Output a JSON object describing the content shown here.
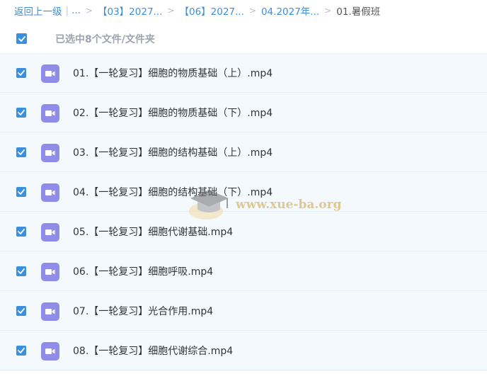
{
  "breadcrumb": {
    "back_label": "返回上一级",
    "pipe": "|",
    "ellipsis": "...",
    "separator": ">",
    "crumbs": [
      "【03】2027...",
      "【06】2027...",
      "04.2027年...",
      "01.暑假班"
    ]
  },
  "selection": {
    "count_label": "已选中8个文件/文件夹",
    "all_checked": true
  },
  "files": [
    {
      "name": "01.【一轮复习】细胞的物质基础（上）.mp4",
      "checked": true
    },
    {
      "name": "02.【一轮复习】细胞的物质基础（下）.mp4",
      "checked": true
    },
    {
      "name": "03.【一轮复习】细胞的结构基础（上）.mp4",
      "checked": true
    },
    {
      "name": "04.【一轮复习】细胞的结构基础（下）.mp4",
      "checked": true
    },
    {
      "name": "05.【一轮复习】细胞代谢基础.mp4",
      "checked": true
    },
    {
      "name": "06.【一轮复习】细胞呼吸.mp4",
      "checked": true
    },
    {
      "name": "07.【一轮复习】光合作用.mp4",
      "checked": true
    },
    {
      "name": "08.【一轮复习】细胞代谢综合.mp4",
      "checked": true
    }
  ],
  "watermark": {
    "text": "www.xue-ba.org",
    "icon": "graduation-cap-icon"
  },
  "icons": {
    "checkbox": "checkbox-checked-icon",
    "file": "video-file-icon"
  },
  "colors": {
    "accent": "#3b8fe0",
    "video_icon": "#8f8de8",
    "list_background": "#f4f9fe",
    "muted_text": "#9ea4ad"
  }
}
